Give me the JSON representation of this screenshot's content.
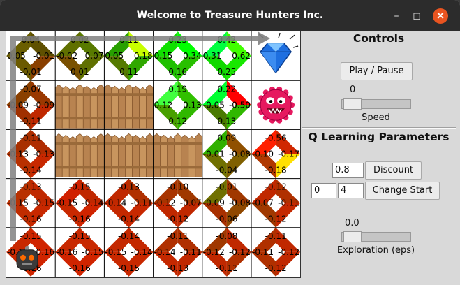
{
  "window": {
    "title": "Welcome to Treasure Hunters Inc."
  },
  "colors": {
    "titlebar": "#2c2c2c",
    "close": "#e95420",
    "panel": "#d9d9d9",
    "path": "#808080"
  },
  "grid": {
    "rows": 5,
    "cols": 6,
    "cells": [
      [
        {
          "kind": "q",
          "up": "0.04",
          "left": "0.05",
          "right": "-0.01",
          "down": "-0.01",
          "cu": "#6a5e00",
          "cl": "#6b5a00",
          "cr": "#5f5000",
          "cd": "#8a4000"
        },
        {
          "kind": "q",
          "up": "0.02",
          "left": "-0.02",
          "right": "0.07",
          "down": "0.01",
          "cu": "#607000",
          "cl": "#7a5000",
          "cr": "#587a00",
          "cd": "#607000"
        },
        {
          "kind": "q",
          "up": "0.11",
          "left": "0.05",
          "right": "0.18",
          "down": "0.11",
          "cu": "#28a000",
          "cl": "#557a00",
          "cr": "#c8ff00",
          "cd": "#30a800"
        },
        {
          "kind": "q",
          "up": "0.23",
          "left": "0.15",
          "right": "0.34",
          "down": "0.16",
          "cu": "#10e000",
          "cl": "#20c000",
          "cr": "#00ff00",
          "cd": "#28c000"
        },
        {
          "kind": "q",
          "up": "0.42",
          "left": "0.31",
          "right": "0.62",
          "down": "0.25",
          "cu": "#00ff40",
          "cl": "#10d800",
          "cr": "#40ff00",
          "cd": "#18e800"
        },
        {
          "kind": "diamond"
        }
      ],
      [
        {
          "kind": "q",
          "up": "-0.07",
          "left": "-0.09",
          "right": "-0.09",
          "down": "-0.11",
          "cu": "#8a4000",
          "cl": "#a03000",
          "cr": "#9a3800",
          "cd": "#c02800"
        },
        {
          "kind": "fence"
        },
        {
          "kind": "fence"
        },
        {
          "kind": "q",
          "up": "0.19",
          "left": "0.12",
          "right": "0.13",
          "down": "0.12",
          "cu": "#40ff40",
          "cl": "#48a000",
          "cr": "#30c000",
          "cd": "#30b800"
        },
        {
          "kind": "q",
          "up": "0.22",
          "left": "-0.05",
          "right": "-0.50",
          "down": "0.13",
          "cu": "#00ff30",
          "cl": "#4a7a00",
          "cr": "#ff0000",
          "cd": "#30b800"
        },
        {
          "kind": "monster"
        }
      ],
      [
        {
          "kind": "q",
          "up": "-0.11",
          "left": "-0.13",
          "right": "-0.13",
          "down": "-0.14",
          "cu": "#a83000",
          "cl": "#b83000",
          "cr": "#b02c00",
          "cd": "#c82800"
        },
        {
          "kind": "fence"
        },
        {
          "kind": "fence"
        },
        {
          "kind": "fence"
        },
        {
          "kind": "q",
          "up": "0.09",
          "left": "-0.01",
          "right": "-0.08",
          "down": "-0.04",
          "cu": "#30b000",
          "cl": "#707000",
          "cr": "#905000",
          "cd": "#806000"
        },
        {
          "kind": "q",
          "up": "-0.56",
          "left": "-0.10",
          "right": "-0.17",
          "down": "-0.18",
          "cu": "#ff2000",
          "cl": "#b03800",
          "cr": "#d02800",
          "cd": "#ffe000"
        }
      ],
      [
        {
          "kind": "q",
          "up": "-0.13",
          "left": "-0.15",
          "right": "-0.15",
          "down": "-0.16",
          "cu": "#b83000",
          "cl": "#c02c00",
          "cr": "#c02800",
          "cd": "#c82800"
        },
        {
          "kind": "q",
          "up": "-0.15",
          "left": "-0.15",
          "right": "-0.14",
          "down": "-0.16",
          "cu": "#d02000",
          "cl": "#c82800",
          "cr": "#c02800",
          "cd": "#d02400"
        },
        {
          "kind": "q",
          "up": "-0.13",
          "left": "-0.14",
          "right": "-0.11",
          "down": "-0.14",
          "cu": "#c02800",
          "cl": "#c42800",
          "cr": "#b03000",
          "cd": "#c82800"
        },
        {
          "kind": "q",
          "up": "-0.10",
          "left": "-0.12",
          "right": "-0.07",
          "down": "-0.12",
          "cu": "#a83400",
          "cl": "#c02800",
          "cr": "#a03800",
          "cd": "#c02800"
        },
        {
          "kind": "q",
          "up": "-0.01",
          "left": "-0.09",
          "right": "-0.08",
          "down": "-0.06",
          "cu": "#707000",
          "cl": "#a83000",
          "cr": "#a03800",
          "cd": "#904800"
        },
        {
          "kind": "q",
          "up": "-0.12",
          "left": "-0.07",
          "right": "-0.11",
          "down": "-0.12",
          "cu": "#c02800",
          "cl": "#a03800",
          "cr": "#b03000",
          "cd": "#c42800"
        }
      ],
      [
        {
          "kind": "q",
          "up": "-0.15",
          "left": "-0.15",
          "right": "-0.16",
          "down": "-0.16",
          "cu": "#c82800",
          "cl": "#c82800",
          "cr": "#d02400",
          "cd": "#d02400",
          "agent": true
        },
        {
          "kind": "q",
          "up": "-0.15",
          "left": "-0.16",
          "right": "-0.15",
          "down": "-0.16",
          "cu": "#c82800",
          "cl": "#d02400",
          "cr": "#c82800",
          "cd": "#d02400"
        },
        {
          "kind": "q",
          "up": "-0.14",
          "left": "-0.15",
          "right": "-0.14",
          "down": "-0.15",
          "cu": "#c42800",
          "cl": "#c82800",
          "cr": "#c42800",
          "cd": "#c82800"
        },
        {
          "kind": "q",
          "up": "-0.11",
          "left": "-0.14",
          "right": "-0.11",
          "down": "-0.13",
          "cu": "#b03000",
          "cl": "#c42800",
          "cr": "#b03000",
          "cd": "#c02800"
        },
        {
          "kind": "q",
          "up": "-0.08",
          "left": "-0.12",
          "right": "-0.12",
          "down": "-0.11",
          "cu": "#a03800",
          "cl": "#c02800",
          "cr": "#c02800",
          "cd": "#b03000"
        },
        {
          "kind": "q",
          "up": "-0.11",
          "left": "-0.11",
          "right": "-0.12",
          "down": "-0.12",
          "cu": "#b03000",
          "cl": "#b03000",
          "cr": "#c02800",
          "cd": "#c02800"
        }
      ]
    ]
  },
  "controls": {
    "heading": "Controls",
    "play_pause": "Play / Pause",
    "speed_value": "0",
    "speed_label": "Speed",
    "speed_level": 0
  },
  "qlearning": {
    "heading": "Q Learning Parameters",
    "discount_value": "0.8",
    "discount_button": "Discount",
    "start_x": "0",
    "start_y": "4",
    "change_start_button": "Change Start",
    "exploration_value": "0.0",
    "exploration_label": "Exploration (eps)",
    "exploration_level": 0
  }
}
